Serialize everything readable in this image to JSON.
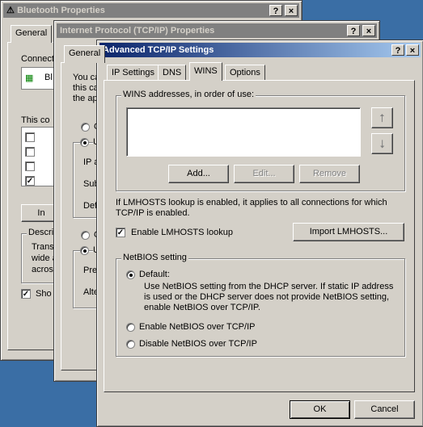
{
  "bluetooth": {
    "title": "Bluetooth Properties",
    "tab_general": "General",
    "connect_label": "Connect",
    "device_label": "Bl",
    "this_con_label": "This co",
    "install_btn": "In",
    "description_label": "Descri",
    "desc_lines": [
      "Trans",
      "wide a",
      "acros"
    ],
    "show_label": "Sho"
  },
  "tcpip": {
    "title": "Internet Protocol (TCP/IP) Properties",
    "tab_general": "General",
    "para_lines": [
      "You ca",
      "this ca",
      "the ap"
    ],
    "ip_label": "IP a",
    "subnet_label": "Sub",
    "default_label": "Def",
    "pref_label": "Pre",
    "alt_label": "Alte",
    "radio_o": "O",
    "radio_u": "U"
  },
  "advanced": {
    "title": "Advanced TCP/IP Settings",
    "help_button": "?",
    "close_button": "×",
    "tabs": [
      "IP Settings",
      "DNS",
      "WINS",
      "Options"
    ],
    "selected_tab": "WINS",
    "wins_group_label": "WINS addresses, in order of use:",
    "up_arrow": "⭡",
    "down_arrow": "⭣",
    "add_button": "Add...",
    "edit_button": "Edit...",
    "remove_button": "Remove",
    "lmhosts_info": "If LMHOSTS lookup is enabled, it applies to all connections for which TCP/IP is enabled.",
    "enable_lmhosts_label": "Enable LMHOSTS lookup",
    "enable_lmhosts_checked": true,
    "import_lmhosts_button": "Import LMHOSTS...",
    "netbios_group_label": "NetBIOS setting",
    "netbios_default_label": "Default:",
    "netbios_default_desc": "Use NetBIOS setting from the DHCP server. If static IP address is used or the DHCP server does not provide NetBIOS setting, enable NetBIOS over TCP/IP.",
    "netbios_enable_label": "Enable NetBIOS over TCP/IP",
    "netbios_disable_label": "Disable NetBIOS over TCP/IP",
    "selected_netbios": "Default:",
    "ok_button": "OK",
    "cancel_button": "Cancel"
  },
  "colors": {
    "desktop": "#3a6ea5",
    "active_title_start": "#0a246a",
    "active_title_end": "#a6caf0",
    "inactive_title": "#808080",
    "face": "#d4d0c8"
  }
}
